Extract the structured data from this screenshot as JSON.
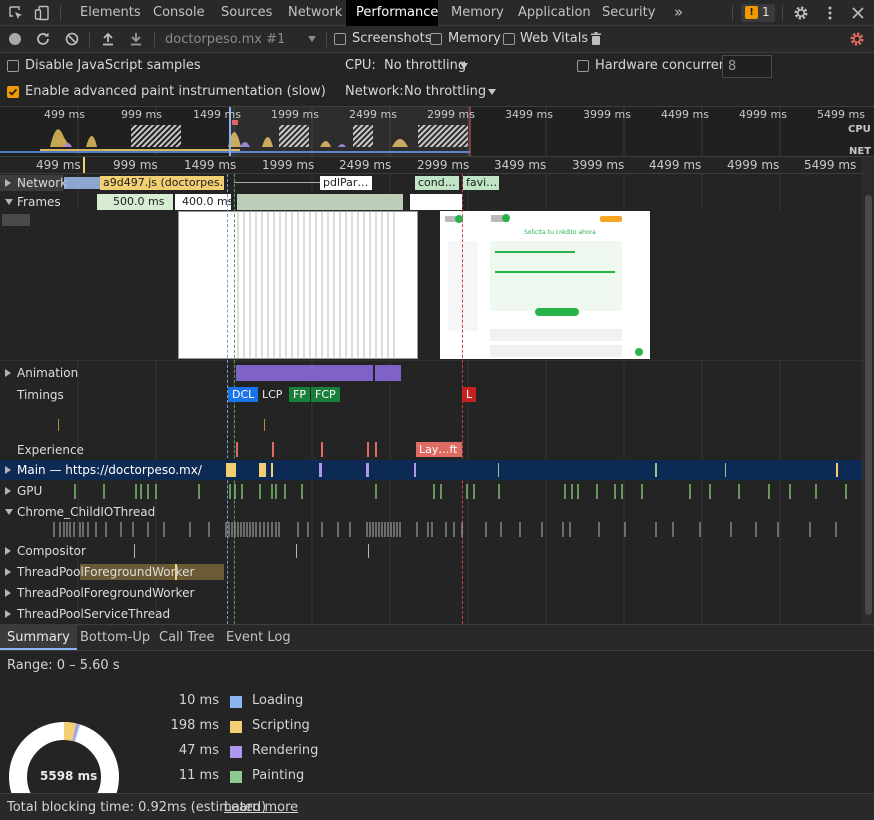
{
  "main_tabs": {
    "elements": "Elements",
    "console": "Console",
    "sources": "Sources",
    "network": "Network",
    "performance": "Performance",
    "memory": "Memory",
    "application": "Application",
    "security": "Security",
    "more": "»",
    "issues_count": "1"
  },
  "toolbar": {
    "profile_select": "doctorpeso.mx #1",
    "screenshots_label": "Screenshots",
    "screenshots_checked": false,
    "memory_label": "Memory",
    "memory_checked": false,
    "web_vitals_label": "Web Vitals",
    "web_vitals_checked": false
  },
  "settings": {
    "disable_js_samples": "Disable JavaScript samples",
    "disable_js_samples_checked": false,
    "advanced_paint": "Enable advanced paint instrumentation (slow)",
    "advanced_paint_checked": true,
    "cpu_label": "CPU:",
    "cpu_value": "No throttling",
    "network_label": "Network:",
    "network_value": "No throttling",
    "hw_concurrency_label": "Hardware concurrency",
    "hw_concurrency_checked": false,
    "hw_concurrency_value": "8"
  },
  "overview": {
    "ticks": [
      "499 ms",
      "999 ms",
      "1499 ms",
      "1999 ms",
      "2499 ms",
      "2999 ms",
      "3499 ms",
      "3999 ms",
      "4499 ms",
      "4999 ms",
      "5499 ms"
    ],
    "cpu_label": "CPU",
    "net_label": "NET"
  },
  "ruler": {
    "ticks": [
      "499 ms",
      "999 ms",
      "1499 ms",
      "1999 ms",
      "2499 ms",
      "2999 ms",
      "3499 ms",
      "3999 ms",
      "4499 ms",
      "4999 ms",
      "5499 ms"
    ]
  },
  "tracks": {
    "network": "Network",
    "network_bar1": "a9d497.js (doctorpes…",
    "network_bar2": "pdlPar…",
    "network_bar3": "cond…",
    "network_bar4": "favi…",
    "frames": "Frames",
    "frame1": "500.0 ms",
    "frame2": "400.0 ms",
    "animation": "Animation",
    "timings": "Timings",
    "dcl": "DCL",
    "lcp": "LCP",
    "fp": "FP",
    "fcp": "FCP",
    "l": "L",
    "experience": "Experience",
    "layout_shift": "Lay…ft",
    "main": "Main — https://doctorpeso.mx/",
    "gpu": "GPU",
    "child_io": "Chrome_ChildIOThread",
    "compositor": "Compositor",
    "pool_fg1": "ThreadPoolForegroundWorker",
    "pool_fg2": "ThreadPoolForegroundWorker",
    "pool_service": "ThreadPoolServiceThread"
  },
  "screenshot_preview": {
    "heading": "Solicita tu crédito ahora"
  },
  "bottom_tabs": {
    "summary": "Summary",
    "bottom_up": "Bottom-Up",
    "call_tree": "Call Tree",
    "event_log": "Event Log"
  },
  "summary": {
    "range": "Range: 0 – 5.60 s",
    "total": "5598 ms",
    "rows": [
      {
        "value": "10 ms",
        "name": "Loading",
        "color": "#8cb4f0"
      },
      {
        "value": "198 ms",
        "name": "Scripting",
        "color": "#f2cf72"
      },
      {
        "value": "47 ms",
        "name": "Rendering",
        "color": "#ae97f0"
      },
      {
        "value": "11 ms",
        "name": "Painting",
        "color": "#8fc98f"
      }
    ]
  },
  "footer": {
    "text": "Total blocking time: 0.92ms (estimated)",
    "link": "Learn more"
  },
  "colors": {
    "accent_blue": "#8ab4f8",
    "scripting": "#f2cf72",
    "rendering": "#ae97f0",
    "painting": "#8fc98f",
    "loading": "#8cb4f0",
    "dcl": "#1a73e8",
    "fp_fcp": "#188038",
    "load": "#c5221f",
    "layout_shift": "#e06b63",
    "main_track": "#0d2a54"
  }
}
